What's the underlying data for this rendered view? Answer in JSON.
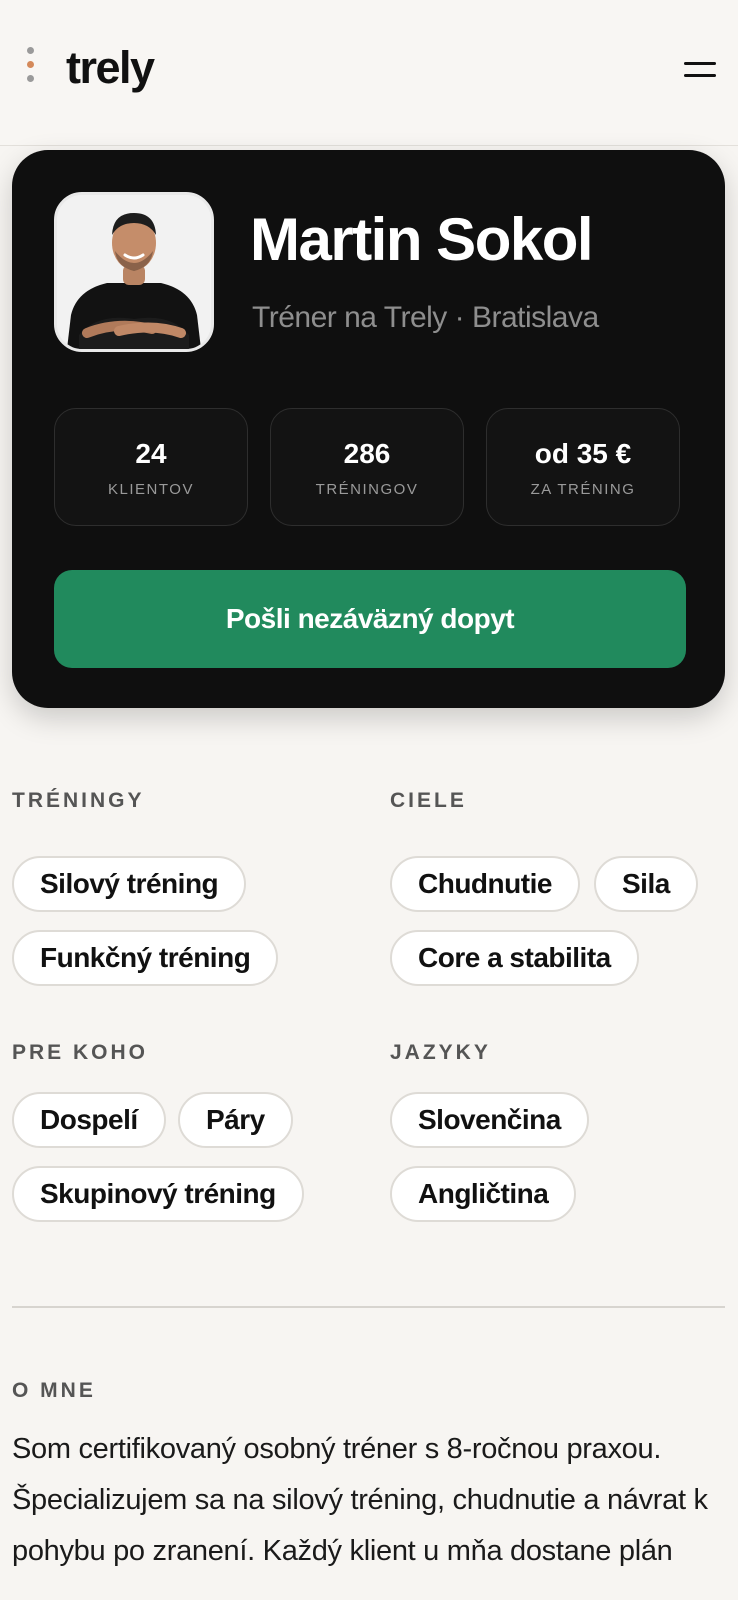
{
  "header": {
    "logo": "trely"
  },
  "profile": {
    "name": "Martin Sokol",
    "subtitle": "Tréner na Trely · Bratislava",
    "stats": [
      {
        "value": "24",
        "label": "KLIENTOV"
      },
      {
        "value": "286",
        "label": "TRÉNINGOV"
      },
      {
        "value": "od 35 €",
        "label": "ZA TRÉNING"
      }
    ],
    "cta_label": "Pošli nezáväzný dopyt"
  },
  "sections": {
    "treningy": {
      "title": "TRÉNINGY",
      "chips": [
        "Silový tréning",
        "Funkčný tréning"
      ]
    },
    "ciele": {
      "title": "CIELE",
      "chips": [
        "Chudnutie",
        "Sila",
        "Core a stabilita"
      ]
    },
    "pre_koho": {
      "title": "PRE KOHO",
      "chips": [
        "Dospelí",
        "Páry",
        "Skupinový tréning"
      ]
    },
    "jazyky": {
      "title": "JAZYKY",
      "chips": [
        "Slovenčina",
        "Angličtina"
      ]
    }
  },
  "about": {
    "title": "O MNE",
    "text": "Som certifikovaný osobný tréner s 8-ročnou praxou. Špecializujem sa na silový tréning, chudnutie a návrat k pohybu po zranení. Každý klient u mňa dostane plán"
  },
  "colors": {
    "accent": "#218a5d",
    "card_bg": "#0f0f0f",
    "page_bg": "#f7f5f2"
  }
}
